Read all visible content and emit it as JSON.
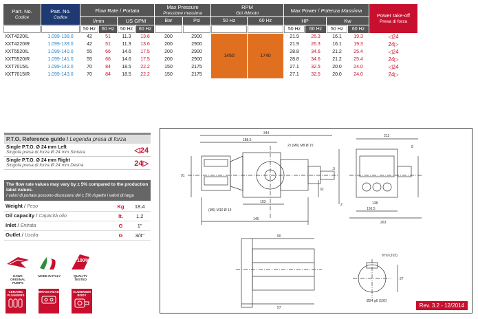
{
  "table": {
    "part_no_label": "Part. No.",
    "codice_label": "Codice",
    "flow_rate_label": "Flow Rate",
    "flow_rate_it": "Portata",
    "lmin_label": "l/min",
    "usgpm_label": "US GPM",
    "max_pressure_label": "Max Pressure",
    "max_pressure_it": "Pressione massima",
    "rpm_label": "RPM",
    "rpm_it": "Giri /Minuto",
    "max_power_label": "Max Power",
    "max_power_it": "Potenza Massima",
    "hp_label": "HP",
    "kw_label": "Kw",
    "pto_label": "Power take-off",
    "pto_it": "Presa di forza",
    "hz50": "50 Hz",
    "hz60": "60 Hz",
    "bar_label": "Bar",
    "psi_label": "Psi",
    "rpm_50": "1450",
    "rpm_60": "1740",
    "rows": [
      {
        "code": "XXT4220IL",
        "part": "1.099-138.0",
        "l50": "42",
        "l60": "51",
        "g50": "11.3",
        "g60": "13.6",
        "bar": "200",
        "psi": "2900",
        "hp50": "21.9",
        "hp60": "26.3",
        "kw50": "16.1",
        "kw60": "19.3",
        "pto": "◁24"
      },
      {
        "code": "XXT4220IR",
        "part": "1.099-139.0",
        "l50": "42",
        "l60": "51",
        "g50": "11.3",
        "g60": "13.6",
        "bar": "200",
        "psi": "2900",
        "hp50": "21.9",
        "hp60": "26.3",
        "kw50": "16.1",
        "kw60": "19.3",
        "pto": "24▷"
      },
      {
        "code": "XXT5520IL",
        "part": "1.099-140.0",
        "l50": "55",
        "l60": "66",
        "g50": "14.6",
        "g60": "17.5",
        "bar": "200",
        "psi": "2900",
        "hp50": "28.8",
        "hp60": "34.6",
        "kw50": "21.2",
        "kw60": "25.4",
        "pto": "◁24"
      },
      {
        "code": "XXT5520IR",
        "part": "1.099-141.0",
        "l50": "55",
        "l60": "66",
        "g50": "14.6",
        "g60": "17.5",
        "bar": "200",
        "psi": "2900",
        "hp50": "28.8",
        "hp60": "34.6",
        "kw50": "21.2",
        "kw60": "25.4",
        "pto": "24▷"
      },
      {
        "code": "XXT7015IL",
        "part": "1.099-142.0",
        "l50": "70",
        "l60": "84",
        "g50": "18.5",
        "g60": "22.2",
        "bar": "150",
        "psi": "2175",
        "hp50": "27.1",
        "hp60": "32.5",
        "kw50": "20.0",
        "kw60": "24.0",
        "pto": "◁24"
      },
      {
        "code": "XXT7015IR",
        "part": "1.099-143.0",
        "l50": "70",
        "l60": "84",
        "g50": "18.5",
        "g60": "22.2",
        "bar": "150",
        "psi": "2175",
        "hp50": "27.1",
        "hp60": "32.5",
        "kw50": "20.0",
        "kw60": "24.0",
        "pto": "24▷"
      }
    ]
  },
  "pto_guide": {
    "title": "P.T.O. Reference guide",
    "title_it": "Legenda presa di forza",
    "left_label": "Single P.T.O. Ø 24 mm Left",
    "left_it": "Singola presa di forza Ø 24 mm Sinistra",
    "left_sym": "◁24",
    "right_label": "Single P.T.O. Ø 24 mm Right",
    "right_it": "Singola presa di forza Ø 24 mm Destra",
    "right_sym": "24▷"
  },
  "note": {
    "en": "The flow rate values may vary by ± 5% compared to the production label values.",
    "it": "I valori di portata possono discostarsi del ± 5% rispetto i valori di targa"
  },
  "props": [
    {
      "label": "Weight",
      "it": "Peso",
      "unit": "Kg",
      "value": "18.4"
    },
    {
      "label": "Oil capacity",
      "it": "Capacità olio",
      "unit": "lt.",
      "value": "1.2"
    },
    {
      "label": "Inlet",
      "it": "Entrata",
      "unit": "G",
      "value": "1\""
    },
    {
      "label": "Outlet",
      "it": "Uscita",
      "unit": "G",
      "value": "3/4\""
    }
  ],
  "badges": {
    "original": "HAWK ORIGINAL PUMPS",
    "italy": "MADE IN ITALY",
    "tested": "QUALITY TESTED",
    "tested_pct": "100%",
    "ceramic": "CERAMIC PLUNGERS",
    "brass": "BRASS HEAD",
    "aluminium": "ALUMINIUM BODY"
  },
  "drawing": {
    "dims": [
      "344",
      "188.5",
      "2x (M6) M8 Ø 15",
      "91",
      "32",
      "103",
      "145",
      "(M6) M10 Ø 14",
      "213",
      "8",
      ".5",
      "2",
      "138",
      "156.5",
      "263",
      "50",
      "57",
      "8 h9 (102)",
      "Ø24 g6 (102)",
      "27"
    ],
    "revision": "Rev. 3.2 - 12/2014"
  },
  "colors": {
    "red": "#c8102e",
    "navy": "#1f3a73",
    "grey": "#555",
    "orange": "#e07020",
    "blue_text": "#2a86c8"
  }
}
